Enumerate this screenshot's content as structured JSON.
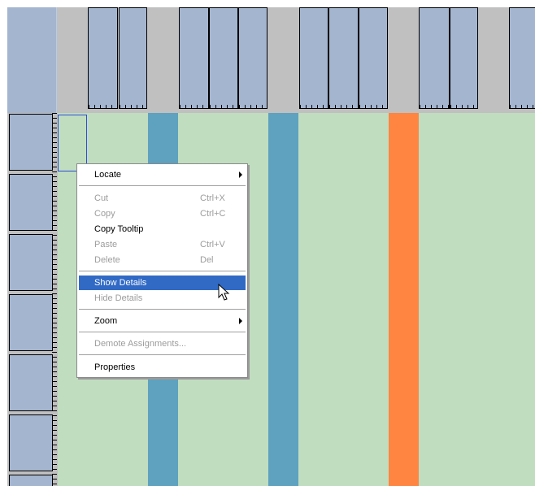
{
  "context_menu": {
    "items": [
      {
        "label": "Locate",
        "shortcut": "",
        "disabled": false,
        "submenu": true
      },
      {
        "label": "Cut",
        "shortcut": "Ctrl+X",
        "disabled": true
      },
      {
        "label": "Copy",
        "shortcut": "Ctrl+C",
        "disabled": true
      },
      {
        "label": "Copy Tooltip",
        "shortcut": "",
        "disabled": false
      },
      {
        "label": "Paste",
        "shortcut": "Ctrl+V",
        "disabled": true
      },
      {
        "label": "Delete",
        "shortcut": "Del",
        "disabled": true
      },
      {
        "label": "Show Details",
        "shortcut": "",
        "disabled": false,
        "highlighted": true
      },
      {
        "label": "Hide Details",
        "shortcut": "",
        "disabled": true
      },
      {
        "label": "Zoom",
        "shortcut": "",
        "disabled": false,
        "submenu": true
      },
      {
        "label": "Demote Assignments...",
        "shortcut": "",
        "disabled": true
      },
      {
        "label": "Properties",
        "shortcut": "",
        "disabled": false
      }
    ]
  },
  "colors": {
    "grid_background": "#c0ddc0",
    "header_background": "#c0c0c0",
    "block_fill": "#a4b5cf",
    "band_blue": "#5ea2c0",
    "band_orange": "#ff8541",
    "menu_highlight": "#316ac5"
  },
  "icons": [
    "submenu-arrow-icon",
    "mouse-pointer-icon"
  ]
}
